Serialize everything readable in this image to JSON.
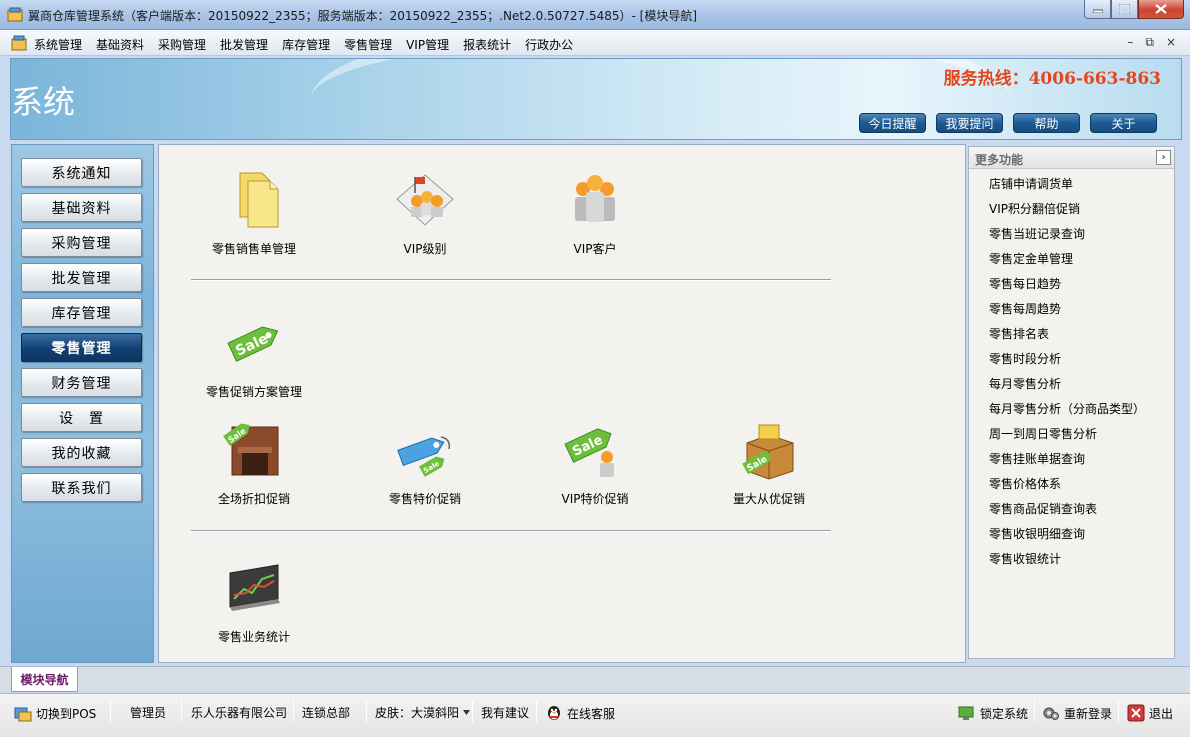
{
  "window": {
    "title": "翼商仓库管理系统（客户端版本：20150922_2355；服务端版本：20150922_2355；.Net2.0.50727.5485）- [模块导航]"
  },
  "menubar": {
    "items": [
      "系统管理",
      "基础资料",
      "采购管理",
      "批发管理",
      "库存管理",
      "零售管理",
      "VIP管理",
      "报表统计",
      "行政办公"
    ],
    "mdi_min": "–",
    "mdi_restore": "⧉",
    "mdi_close": "×"
  },
  "banner": {
    "heading": "系统",
    "hotline": "服务热线：4006-663-863",
    "buttons": [
      "今日提醒",
      "我要提问",
      "帮助",
      "关于"
    ]
  },
  "leftnav": {
    "items": [
      "系统通知",
      "基础资料",
      "采购管理",
      "批发管理",
      "库存管理",
      "零售管理",
      "财务管理",
      "设　置",
      "我的收藏",
      "联系我们"
    ],
    "active_index": 5
  },
  "main": {
    "functions": [
      {
        "label": "零售销售单管理",
        "icon": "documents-icon"
      },
      {
        "label": "VIP级别",
        "icon": "vip-level-icon"
      },
      {
        "label": "VIP客户",
        "icon": "vip-customers-icon"
      },
      {
        "label": "零售促销方案管理",
        "icon": "sale-tag-icon"
      },
      {
        "label": "全场折扣促销",
        "icon": "store-sale-icon"
      },
      {
        "label": "零售特价促销",
        "icon": "price-tag-icon"
      },
      {
        "label": "VIP特价促销",
        "icon": "vip-sale-icon"
      },
      {
        "label": "量大从优促销",
        "icon": "bulk-sale-box-icon"
      },
      {
        "label": "零售业务统计",
        "icon": "stats-chart-icon"
      }
    ]
  },
  "more": {
    "title": "更多功能",
    "chevron": "›",
    "items": [
      "店铺申请调货单",
      "VIP积分翻倍促销",
      "零售当班记录查询",
      "零售定金单管理",
      "零售每日趋势",
      "零售每周趋势",
      "零售排名表",
      "零售时段分析",
      "每月零售分析",
      "每月零售分析（分商品类型）",
      "周一到周日零售分析",
      "零售挂账单据查询",
      "零售价格体系",
      "零售商品促销查询表",
      "零售收银明细查询",
      "零售收银统计"
    ]
  },
  "tabstrip": {
    "tab_label": "模块导航"
  },
  "status": {
    "switch_pos": "切换到POS",
    "user": "管理员",
    "company": "乐人乐器有限公司",
    "branch": "连锁总部",
    "skin": "皮肤：大漠斜阳",
    "suggest": "我有建议",
    "online_service": "在线客服",
    "lock": "锁定系统",
    "relogin": "重新登录",
    "exit": "退出"
  },
  "colors": {
    "hotline": "#e4461e",
    "nav_active": "#123f70",
    "tab_text": "#6a1b6a"
  }
}
